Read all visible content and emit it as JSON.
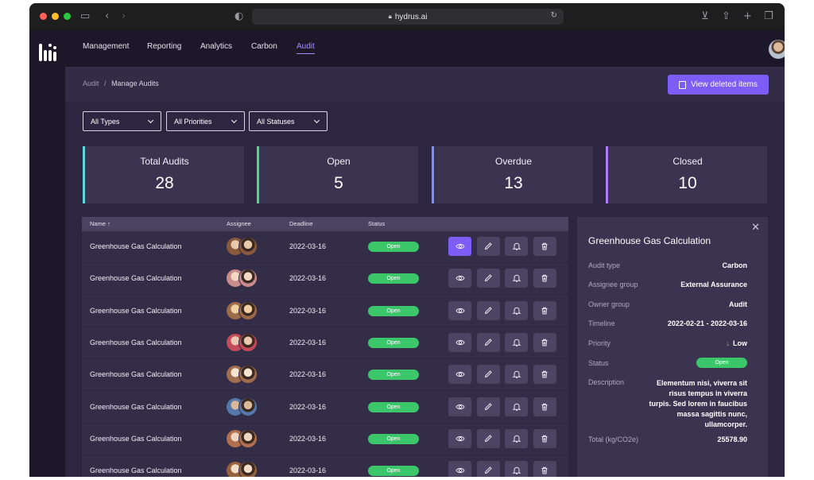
{
  "browser": {
    "url": "hydrus.ai"
  },
  "nav": {
    "items": [
      "Management",
      "Reporting",
      "Analytics",
      "Carbon",
      "Audit"
    ],
    "active": "Audit"
  },
  "breadcrumb": {
    "parent": "Audit",
    "separator": "/",
    "current": "Manage Audits"
  },
  "actions": {
    "view_deleted": "View deleted items"
  },
  "filters": {
    "type": "All Types",
    "priority": "All Priorities",
    "status": "All Statuses"
  },
  "stats": [
    {
      "label": "Total Audits",
      "value": "28",
      "color": "#5ed4dc"
    },
    {
      "label": "Open",
      "value": "5",
      "color": "#4fd68a"
    },
    {
      "label": "Overdue",
      "value": "13",
      "color": "#7d8ff5"
    },
    {
      "label": "Closed",
      "value": "10",
      "color": "#b07df5"
    }
  ],
  "table": {
    "headers": {
      "name": "Name ↑",
      "assignee": "Assignee",
      "deadline": "Deadline",
      "status": "Status"
    },
    "rows": [
      {
        "name": "Greenhouse Gas Calculation",
        "deadline": "2022-03-16",
        "status": "Open"
      },
      {
        "name": "Greenhouse Gas Calculation",
        "deadline": "2022-03-16",
        "status": "Open"
      },
      {
        "name": "Greenhouse Gas Calculation",
        "deadline": "2022-03-16",
        "status": "Open"
      },
      {
        "name": "Greenhouse Gas Calculation",
        "deadline": "2022-03-16",
        "status": "Open"
      },
      {
        "name": "Greenhouse Gas Calculation",
        "deadline": "2022-03-16",
        "status": "Open"
      },
      {
        "name": "Greenhouse Gas Calculation",
        "deadline": "2022-03-16",
        "status": "Open"
      },
      {
        "name": "Greenhouse Gas Calculation",
        "deadline": "2022-03-16",
        "status": "Open"
      },
      {
        "name": "Greenhouse Gas Calculation",
        "deadline": "2022-03-16",
        "status": "Open"
      }
    ],
    "row_actions": [
      "eye-icon",
      "pencil-icon",
      "bell-icon",
      "trash-icon"
    ]
  },
  "detail": {
    "title": "Greenhouse Gas Calculation",
    "audit_type": {
      "label": "Audit type",
      "value": "Carbon"
    },
    "assignee_group": {
      "label": "Assignee group",
      "value": "External Assurance"
    },
    "owner_group": {
      "label": "Owner group",
      "value": "Audit"
    },
    "timeline": {
      "label": "Timeline",
      "value": "2022-02-21 - 2022-03-16"
    },
    "priority": {
      "label": "Priority",
      "value": "Low"
    },
    "status": {
      "label": "Status",
      "value": "Open"
    },
    "description": {
      "label": "Description",
      "value": "Elementum nisi, viverra sit risus tempus in viverra turpis. Sed lorem in faucibus massa sagittis nunc, ullamcorper."
    },
    "total": {
      "label": "Total (kg/CO2e)",
      "value": "25578.90"
    }
  },
  "colors": {
    "accent": "#7d5df5",
    "status_open": "#3cc66a",
    "priority_low": "#f0a830"
  }
}
